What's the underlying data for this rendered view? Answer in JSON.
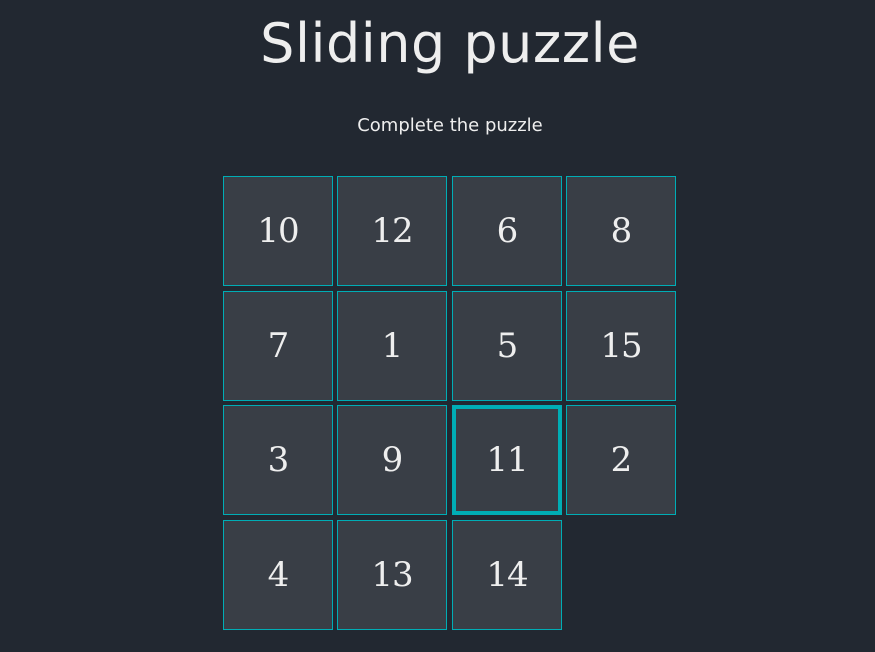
{
  "header": {
    "title": "Sliding puzzle",
    "subtitle": "Complete the puzzle"
  },
  "board": {
    "rows": 4,
    "cols": 4,
    "tiles": [
      [
        "10",
        "12",
        "6",
        "8"
      ],
      [
        "7",
        "1",
        "5",
        "15"
      ],
      [
        "3",
        "9",
        "11",
        "2"
      ],
      [
        "4",
        "13",
        "14",
        ""
      ]
    ],
    "selected_tile": "11",
    "empty_cell": {
      "row": 4,
      "col": 4
    }
  },
  "colors": {
    "background": "#222831",
    "tile": "#393e46",
    "accent": "#00adb5",
    "text": "#eeeeee"
  }
}
